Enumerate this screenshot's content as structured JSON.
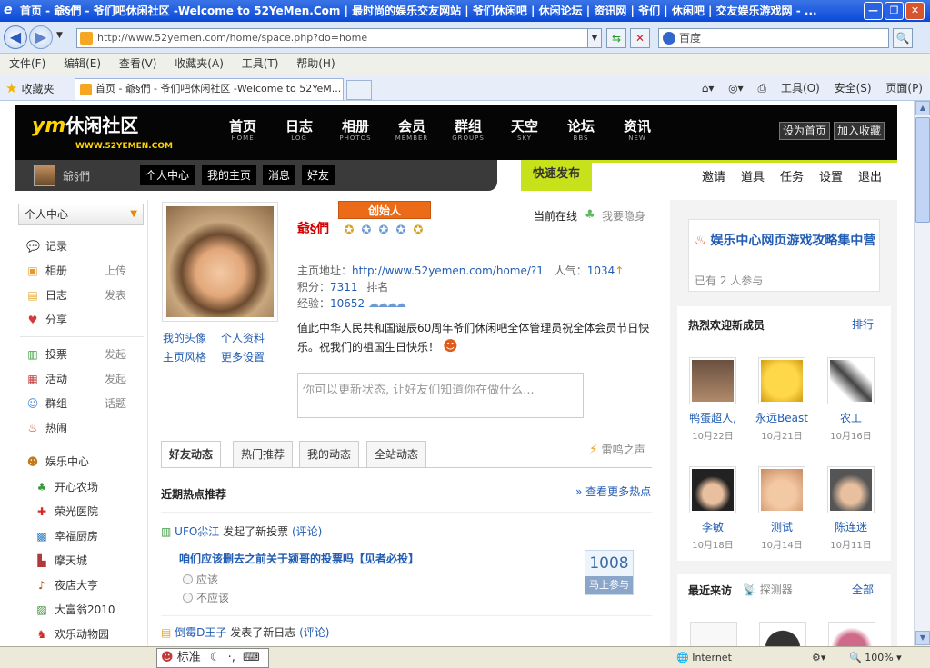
{
  "browser": {
    "title": "首页 - 爺§們 - 爷们吧休闲社区 -Welcome to 52YeMen.Com | 最时尚的娱乐交友网站 | 爷们休闲吧 | 休闲论坛 | 资讯网 | 爷们 | 休闲吧 | 交友娱乐游戏网 - ...",
    "url": "http://www.52yemen.com/home/space.php?do=home",
    "search_placeholder": "百度",
    "menu": [
      "文件(F)",
      "编辑(E)",
      "查看(V)",
      "收藏夹(A)",
      "工具(T)",
      "帮助(H)"
    ],
    "favorites": "收藏夹",
    "tab_title": "首页 - 爺§們 - 爷们吧休闲社区 -Welcome to 52YeM...",
    "right_tools": [
      "工具(O)",
      "安全(S)",
      "页面(P)"
    ],
    "status_zone": "Internet",
    "zoom": "100%",
    "ime_label": "标准"
  },
  "site": {
    "logo_main": "休闲社区",
    "logo_ym": "ym",
    "logo_url": "WWW.52YEMEN.COM",
    "nav": [
      {
        "cn": "首页",
        "en": "HOME"
      },
      {
        "cn": "日志",
        "en": "LOG"
      },
      {
        "cn": "相册",
        "en": "PHOTOS"
      },
      {
        "cn": "会员",
        "en": "MEMBER"
      },
      {
        "cn": "群组",
        "en": "GROUPS"
      },
      {
        "cn": "天空",
        "en": "SKY"
      },
      {
        "cn": "论坛",
        "en": "BBS"
      },
      {
        "cn": "资讯",
        "en": "NEW"
      }
    ],
    "set_home": "设为首页",
    "add_fav": "加入收藏"
  },
  "userbar": {
    "name": "爺§們",
    "buttons": [
      "个人中心",
      "我的主页",
      "消息",
      "好友"
    ],
    "quick_publish": "快速发布",
    "links": [
      "邀请",
      "道具",
      "任务",
      "设置",
      "退出"
    ]
  },
  "left": {
    "header": "个人中心",
    "items": [
      {
        "label": "记录",
        "extra": ""
      },
      {
        "label": "相册",
        "extra": "上传"
      },
      {
        "label": "日志",
        "extra": "发表"
      },
      {
        "label": "分享",
        "extra": ""
      },
      {
        "label": "投票",
        "extra": "发起"
      },
      {
        "label": "活动",
        "extra": "发起"
      },
      {
        "label": "群组",
        "extra": "话题"
      },
      {
        "label": "热闹",
        "extra": ""
      }
    ],
    "ent_title": "娱乐中心",
    "ent_items": [
      "开心农场",
      "荣光医院",
      "幸福厨房",
      "摩天城",
      "夜店大亨",
      "大富翁2010",
      "欢乐动物园"
    ]
  },
  "profile": {
    "name": "爺§們",
    "founder": "创始人",
    "online": "当前在线",
    "hide": "我要隐身",
    "links": [
      "我的头像",
      "个人资料",
      "主页风格",
      "更多设置"
    ],
    "homepage_label": "主页地址：",
    "homepage": "http://www.52yemen.com/home/?1",
    "popularity_label": "人气：",
    "popularity": "1034",
    "points_label": "积分：",
    "points": "7311",
    "rank_label": "排名",
    "exp_label": "经验：",
    "exp": "10652",
    "blessing": "值此中华人民共和国诞辰60周年爷们休闲吧全体管理员祝全体会员节日快乐。祝我们的祖国生日快乐！",
    "status_placeholder": "你可以更新状态, 让好友们知道你在做什么..."
  },
  "feed": {
    "tabs": [
      "好友动态",
      "热门推荐",
      "我的动态",
      "全站动态"
    ],
    "thunder": "雷鸣之声",
    "hot_title": "近期热点推荐",
    "more_hot": "» 查看更多热点",
    "poll_user": "UFO尛江",
    "poll_action": "发起了新投票",
    "comment": "(评论)",
    "poll_title": "咱们应该删去之前关于颍哥的投票吗【见者必投】",
    "options": [
      "应该",
      "不应该"
    ],
    "vote_count": "1008",
    "vote_go": "马上参与",
    "blog_user": "倒霉D王子",
    "blog_action": "发表了新日志"
  },
  "right": {
    "game_title": "娱乐中心网页游戏攻略集中营",
    "game_meta": "已有 2 人参与",
    "welcome_title": "热烈欢迎新成员",
    "rank_link": "排行",
    "members": [
      {
        "name": "鸭蛋超人,",
        "date": "10月22日"
      },
      {
        "name": "永远Beast",
        "date": "10月21日"
      },
      {
        "name": "农工",
        "date": "10月16日"
      },
      {
        "name": "李敏",
        "date": "10月18日"
      },
      {
        "name": "测试",
        "date": "10月14日"
      },
      {
        "name": "陈连迷",
        "date": "10月11日"
      }
    ],
    "visit_title": "最近来访",
    "detector": "探测器",
    "all_link": "全部"
  }
}
